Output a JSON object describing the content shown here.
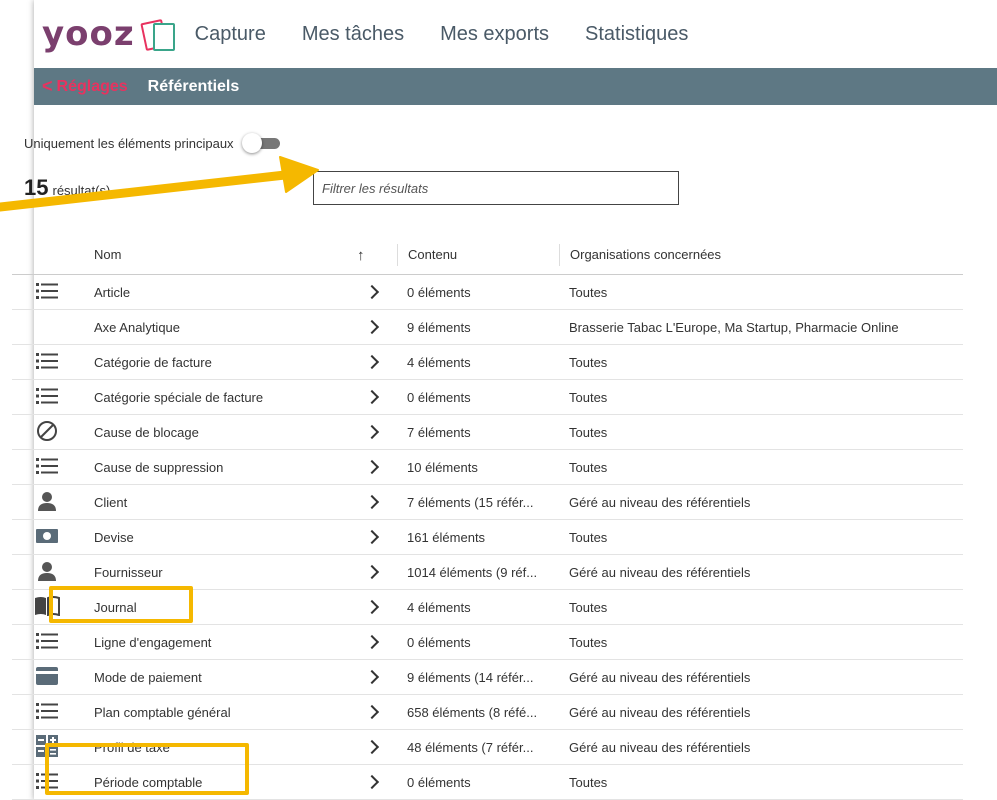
{
  "app": {
    "logo_text": "yooz",
    "nav": [
      "Capture",
      "Mes tâches",
      "Mes exports",
      "Statistiques"
    ]
  },
  "breadcrumb": {
    "back": "Réglages",
    "current": "Référentiels"
  },
  "toggle": {
    "label": "Uniquement les éléments principaux",
    "state": "off"
  },
  "results": {
    "count": "15",
    "label": "résultat(s)"
  },
  "filter": {
    "placeholder": "Filtrer les résultats"
  },
  "table": {
    "headers": {
      "name": "Nom",
      "sort": "↑",
      "content": "Contenu",
      "orgs": "Organisations concernées"
    },
    "rows": [
      {
        "icon": "list-icon",
        "name": "Article",
        "content": "0 éléments",
        "orgs": "Toutes"
      },
      {
        "icon": "none",
        "name": "Axe Analytique",
        "content": "9 éléments",
        "orgs": "Brasserie Tabac L'Europe, Ma Startup, Pharmacie Online"
      },
      {
        "icon": "list-icon",
        "name": "Catégorie de facture",
        "content": "4 éléments",
        "orgs": "Toutes"
      },
      {
        "icon": "list-icon",
        "name": "Catégorie spéciale de facture",
        "content": "0 éléments",
        "orgs": "Toutes"
      },
      {
        "icon": "block-icon",
        "name": "Cause de blocage",
        "content": "7 éléments",
        "orgs": "Toutes"
      },
      {
        "icon": "list-icon",
        "name": "Cause de suppression",
        "content": "10 éléments",
        "orgs": "Toutes"
      },
      {
        "icon": "person-icon",
        "name": "Client",
        "content": "7 éléments (15 référ...",
        "orgs": "Géré au niveau des référentiels"
      },
      {
        "icon": "money-icon",
        "name": "Devise",
        "content": "161 éléments",
        "orgs": "Toutes"
      },
      {
        "icon": "person-icon",
        "name": "Fournisseur",
        "content": "1014 éléments (9 réf...",
        "orgs": "Géré au niveau des référentiels"
      },
      {
        "icon": "book-icon",
        "name": "Journal",
        "content": "4 éléments",
        "orgs": "Toutes"
      },
      {
        "icon": "list-icon",
        "name": "Ligne d'engagement",
        "content": "0 éléments",
        "orgs": "Toutes"
      },
      {
        "icon": "card-icon",
        "name": "Mode de paiement",
        "content": "9 éléments (14 référ...",
        "orgs": "Géré au niveau des référentiels"
      },
      {
        "icon": "list-icon",
        "name": "Plan comptable général",
        "content": "658 éléments (8 réfé...",
        "orgs": "Géré au niveau des référentiels"
      },
      {
        "icon": "calc-icon",
        "name": "Profil de taxe",
        "content": "48 éléments (7 référ...",
        "orgs": "Géré au niveau des référentiels"
      },
      {
        "icon": "list-icon",
        "name": "Période comptable",
        "content": "0 éléments",
        "orgs": "Toutes"
      }
    ]
  },
  "colors": {
    "accent": "#e8325f",
    "subbar": "#5e7884",
    "highlight": "#f5b800",
    "logo": "#7b3f6e"
  }
}
